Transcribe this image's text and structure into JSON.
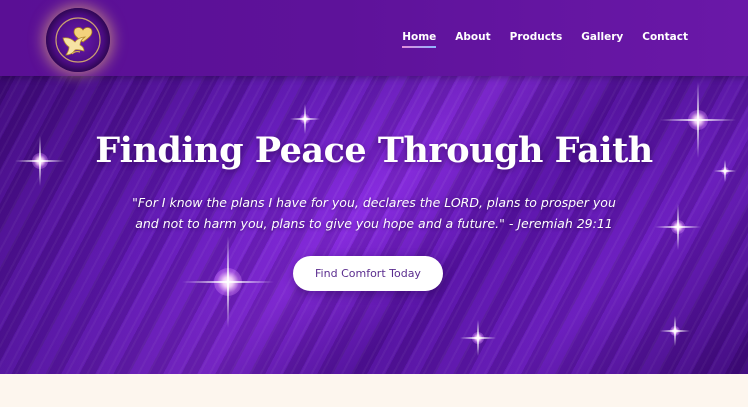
{
  "nav": {
    "items": [
      {
        "label": "Home",
        "active": true
      },
      {
        "label": "About",
        "active": false
      },
      {
        "label": "Products",
        "active": false
      },
      {
        "label": "Gallery",
        "active": false
      },
      {
        "label": "Contact",
        "active": false
      }
    ]
  },
  "logo": {
    "icon": "dove-heart-emblem-icon"
  },
  "hero": {
    "title": "Finding Peace Through Faith",
    "quote": "\"For I know the plans I have for you, declares the LORD, plans to prosper you and not to harm you, plans to give you hope and a future.\" - Jeremiah 29:11",
    "cta_label": "Find Comfort Today"
  },
  "colors": {
    "header_bg": "#5a0f95",
    "hero_accent": "#8a2be2",
    "cta_text": "#5b2d8f",
    "page_bg": "#fdf6ee"
  }
}
